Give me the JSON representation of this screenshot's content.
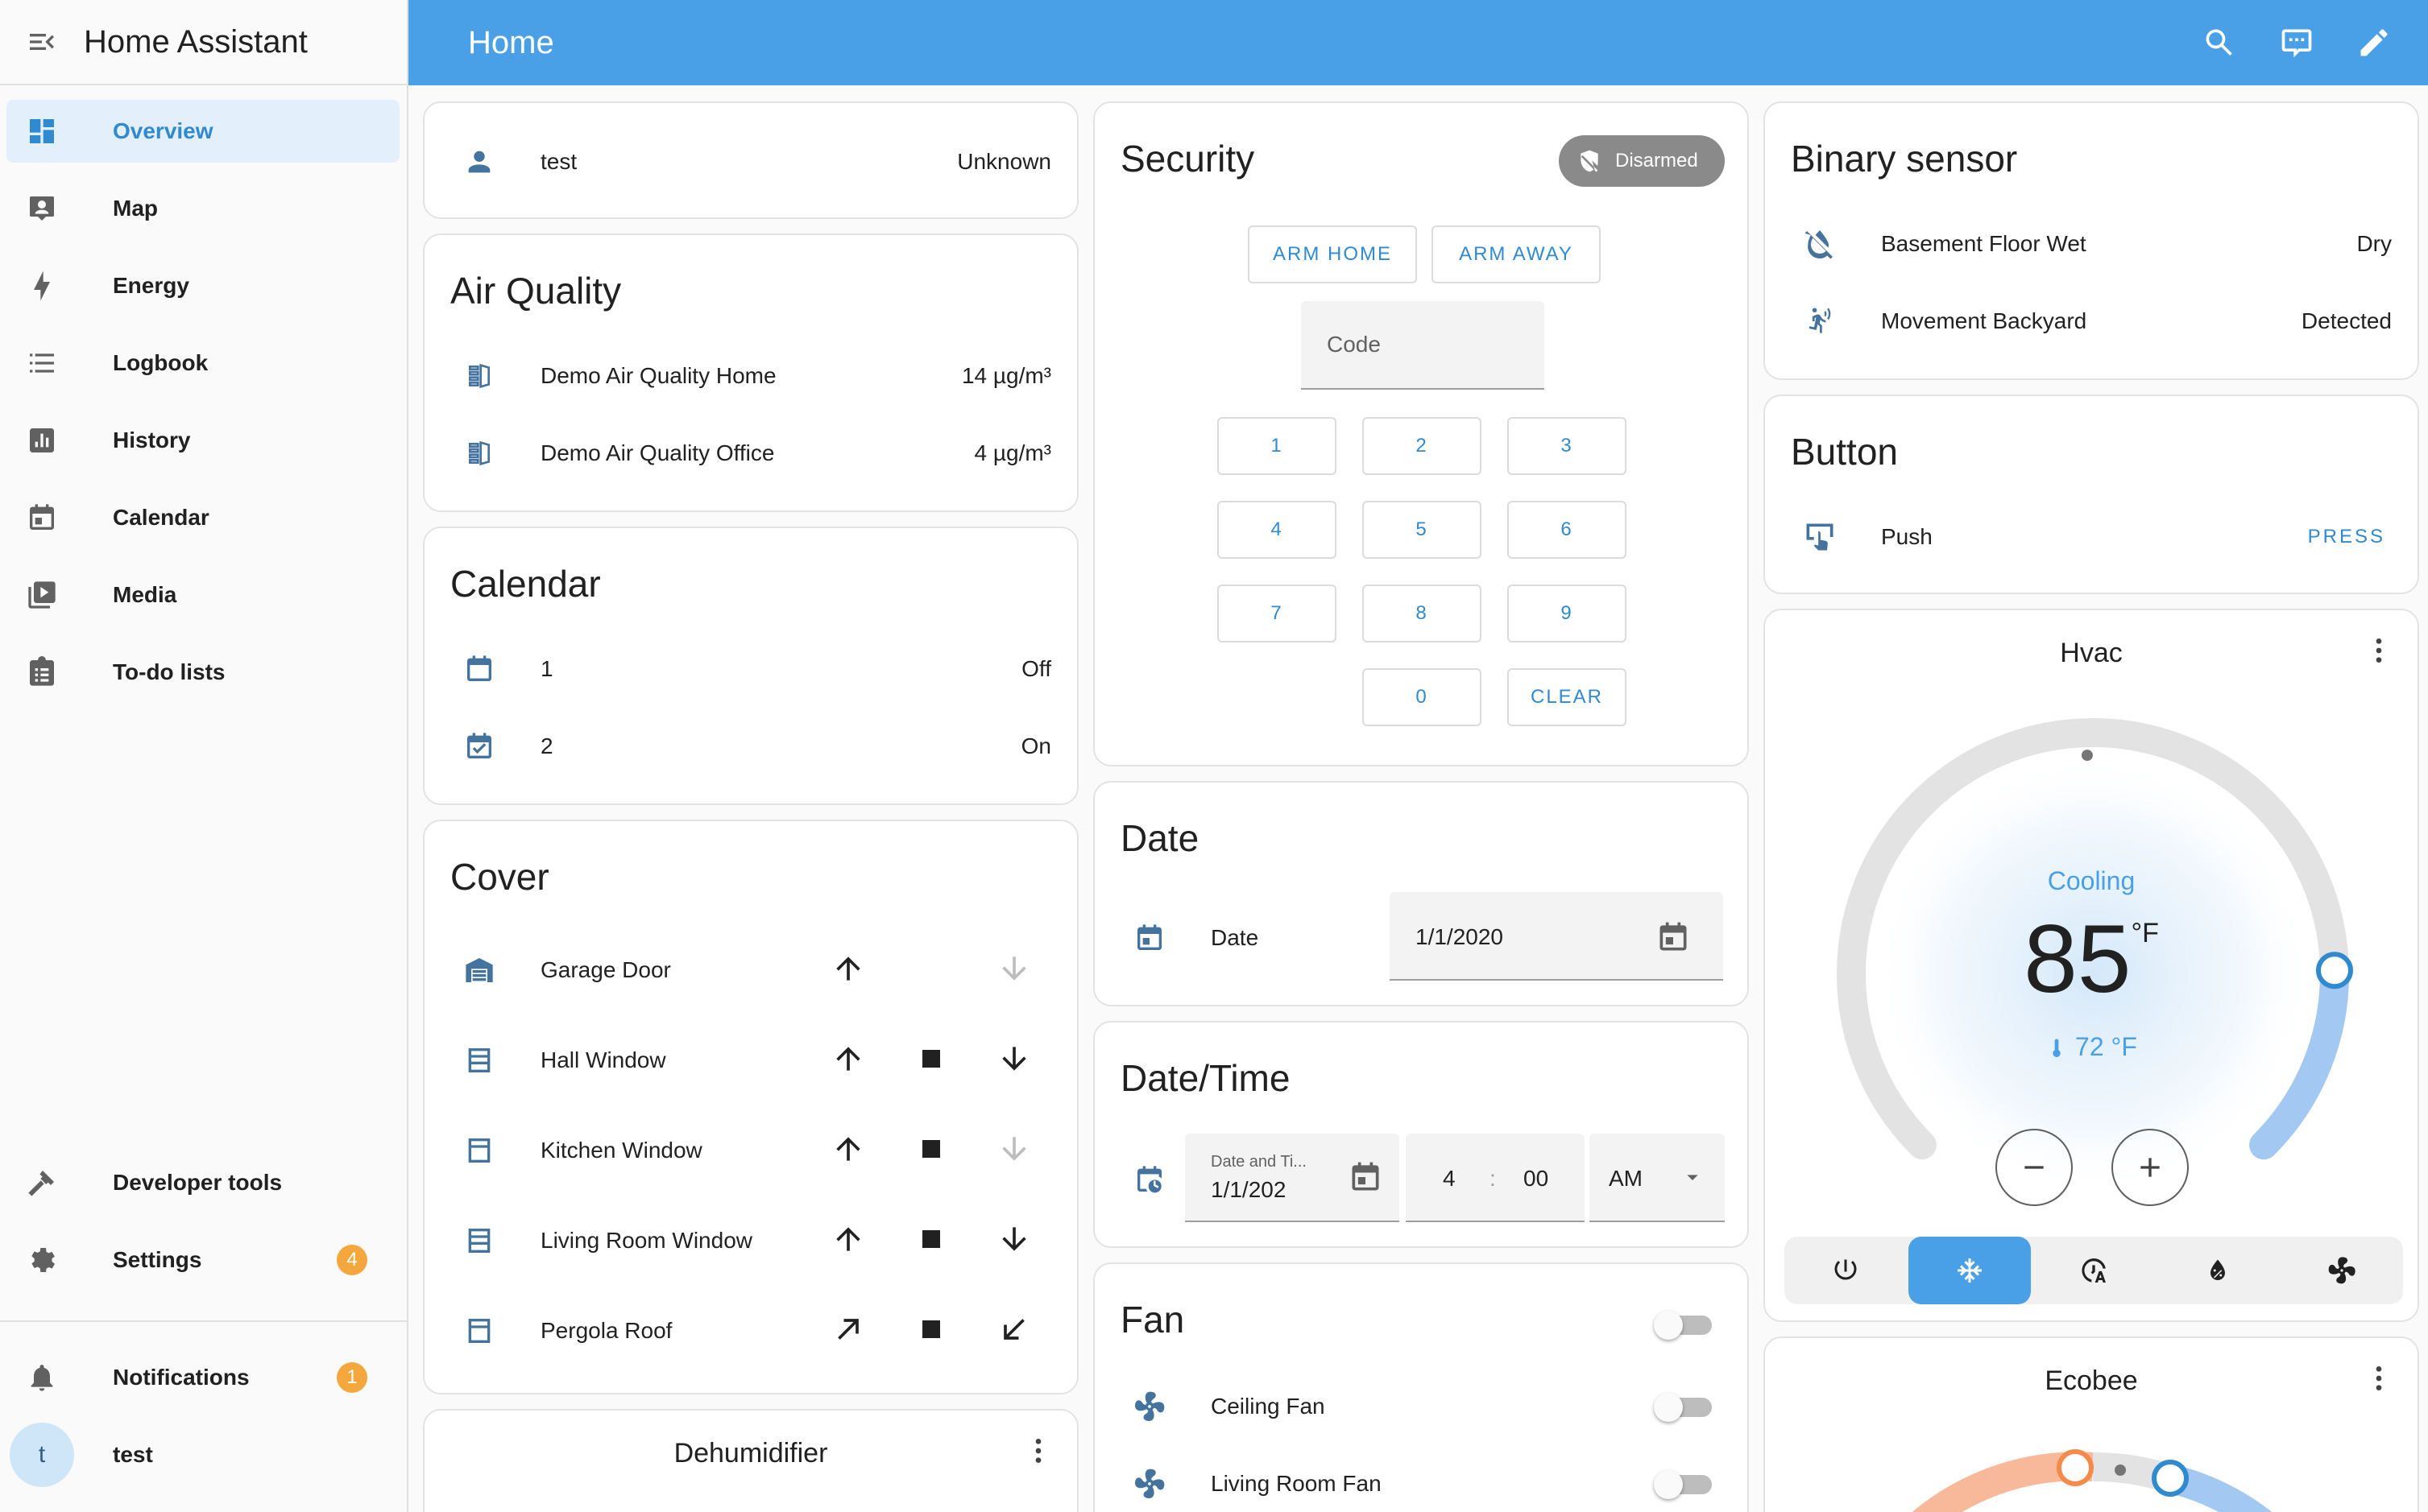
{
  "app": {
    "title": "Home Assistant"
  },
  "sidebar": {
    "items": [
      {
        "label": "Overview",
        "icon": "dashboard-icon"
      },
      {
        "label": "Map",
        "icon": "map-icon"
      },
      {
        "label": "Energy",
        "icon": "lightning-bolt-icon"
      },
      {
        "label": "Logbook",
        "icon": "list-icon"
      },
      {
        "label": "History",
        "icon": "chart-box-icon"
      },
      {
        "label": "Calendar",
        "icon": "calendar-icon"
      },
      {
        "label": "Media",
        "icon": "media-play-icon"
      },
      {
        "label": "To-do lists",
        "icon": "clipboard-list-icon"
      }
    ],
    "bottom": {
      "developer_tools": "Developer tools",
      "settings": "Settings",
      "settings_badge": "4",
      "notifications": "Notifications",
      "notifications_badge": "1",
      "user_initial": "t",
      "user_name": "test"
    }
  },
  "header": {
    "title": "Home"
  },
  "cards": {
    "person": {
      "name": "test",
      "state": "Unknown"
    },
    "air_quality": {
      "title": "Air Quality",
      "rows": [
        {
          "name": "Demo Air Quality Home",
          "state": "14 µg/m³"
        },
        {
          "name": "Demo Air Quality Office",
          "state": "4 µg/m³"
        }
      ]
    },
    "calendar": {
      "title": "Calendar",
      "rows": [
        {
          "name": "1",
          "state": "Off"
        },
        {
          "name": "2",
          "state": "On"
        }
      ]
    },
    "cover": {
      "title": "Cover",
      "rows": [
        {
          "name": "Garage Door"
        },
        {
          "name": "Hall Window"
        },
        {
          "name": "Kitchen Window"
        },
        {
          "name": "Living Room Window"
        },
        {
          "name": "Pergola Roof"
        }
      ]
    },
    "dehumidifier": {
      "title": "Dehumidifier"
    },
    "security": {
      "title": "Security",
      "status": "Disarmed",
      "arm_home": "ARM HOME",
      "arm_away": "ARM AWAY",
      "code_placeholder": "Code",
      "keys": [
        "1",
        "2",
        "3",
        "4",
        "5",
        "6",
        "7",
        "8",
        "9",
        "0"
      ],
      "clear": "CLEAR"
    },
    "date": {
      "title": "Date",
      "label": "Date",
      "value": "1/1/2020"
    },
    "datetime": {
      "title": "Date/Time",
      "date_label": "Date and Ti...",
      "date_value": "1/1/202",
      "hour": "4",
      "separator": ":",
      "minute": "00",
      "ampm": "AM"
    },
    "fan": {
      "title": "Fan",
      "rows": [
        {
          "name": "Ceiling Fan"
        },
        {
          "name": "Living Room Fan"
        }
      ]
    },
    "binary_sensor": {
      "title": "Binary sensor",
      "rows": [
        {
          "name": "Basement Floor Wet",
          "state": "Dry"
        },
        {
          "name": "Movement Backyard",
          "state": "Detected"
        }
      ]
    },
    "button": {
      "title": "Button",
      "name": "Push",
      "action": "PRESS"
    },
    "hvac": {
      "title": "Hvac",
      "action": "Cooling",
      "target": "85",
      "unit": "°F",
      "current": "72 °F",
      "target_fraction": 0.83
    },
    "ecobee": {
      "title": "Ecobee"
    }
  },
  "colors": {
    "primary": "#4aa0e6",
    "accent": "#2f8ad0",
    "badge": "#f3a73c",
    "heat": "#f48b4b"
  }
}
